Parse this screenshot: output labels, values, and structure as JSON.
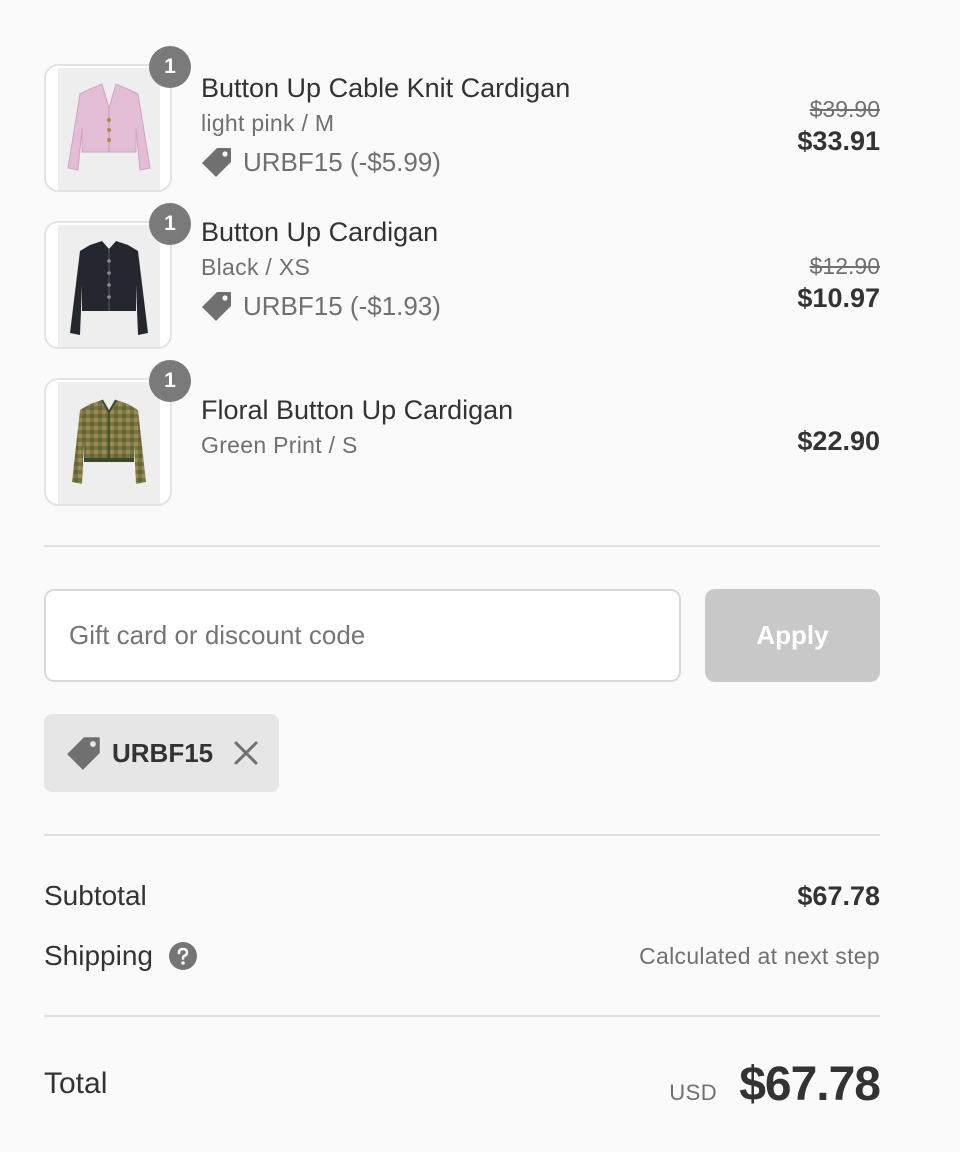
{
  "line_items": [
    {
      "quantity": "1",
      "title": "Button Up Cable Knit Cardigan",
      "variant": "light pink / M",
      "discount": "URBF15 (-$5.99)",
      "price_original": "$39.90",
      "price_final": "$33.91",
      "image_color": "#e3bcd6"
    },
    {
      "quantity": "1",
      "title": "Button Up Cardigan",
      "variant": "Black / XS",
      "discount": "URBF15 (-$1.93)",
      "price_original": "$12.90",
      "price_final": "$10.97",
      "image_color": "#24272e"
    },
    {
      "quantity": "1",
      "title": "Floral Button Up Cardigan",
      "variant": "Green Print / S",
      "price_final": "$22.90",
      "image_color": "#6b6b3e"
    }
  ],
  "discount_form": {
    "placeholder": "Gift card or discount code",
    "value": "",
    "apply_label": "Apply"
  },
  "applied_discount": {
    "code": "URBF15",
    "icon": "tag-icon",
    "remove_icon": "close-icon"
  },
  "summary": {
    "subtotal_label": "Subtotal",
    "subtotal_value": "$67.78",
    "shipping_label": "Shipping",
    "shipping_note": "Calculated at next step",
    "help_icon": "question-circle-icon"
  },
  "total": {
    "label": "Total",
    "currency": "USD",
    "value": "$67.78"
  },
  "colors": {
    "background": "#fafafa",
    "badge": "#7a7a7a",
    "apply_disabled": "#c8c8c8",
    "chip_background": "#e6e6e6",
    "divider": "#e1e1e1"
  }
}
